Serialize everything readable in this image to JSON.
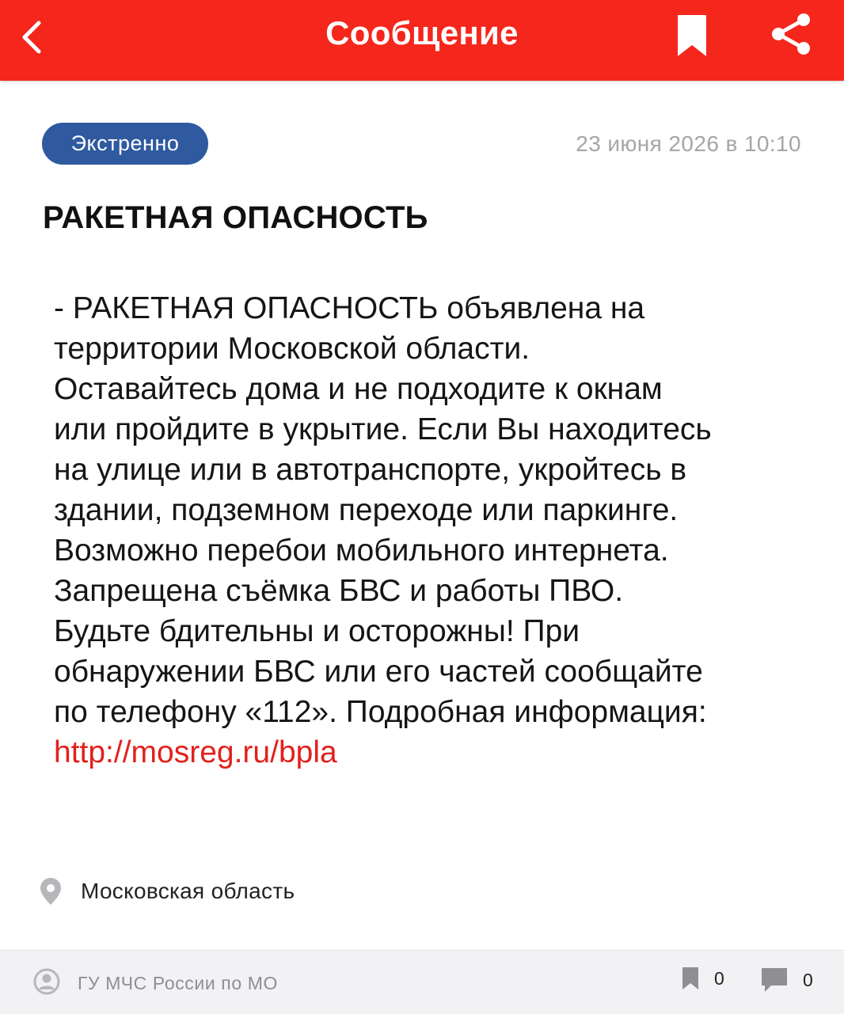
{
  "header": {
    "title": "Сообщение",
    "accent_color": "#f5261c",
    "back_icon": "chevron-left-icon",
    "bookmark_icon": "bookmark-icon",
    "share_icon": "share-icon"
  },
  "message": {
    "badge": "Экстренно",
    "badge_color": "#2f5aa0",
    "timestamp": "23 июня 2026 в 10:10",
    "title": "РАКЕТНАЯ ОПАСНОСТЬ",
    "body": "- РАКЕТНАЯ ОПАСНОСТЬ объявлена на\nтерритории Московской области.\nОставайтесь дома и не подходите к окнам\nили пройдите в укрытие. Если Вы находитесь\nна улице или в автотранспорте, укройтесь в\nздании, подземном переходе или паркинге.\nВозможно перебои мобильного интернета.\nЗапрещена съёмка БВС и работы ПВО.\nБудьте бдительны и осторожны! При\nобнаружении БВС или его частей сообщайте\nпо телефону «112». Подробная информация:",
    "link": "http://mosreg.ru/bpla",
    "link_color": "#e3201b",
    "location": "Московская область",
    "location_icon": "location-pin-icon"
  },
  "footer": {
    "source": "ГУ МЧС России по МО",
    "source_icon": "user-circle-icon",
    "bookmark_count": "0",
    "comment_count": "0",
    "comment_icon": "comment-icon"
  }
}
